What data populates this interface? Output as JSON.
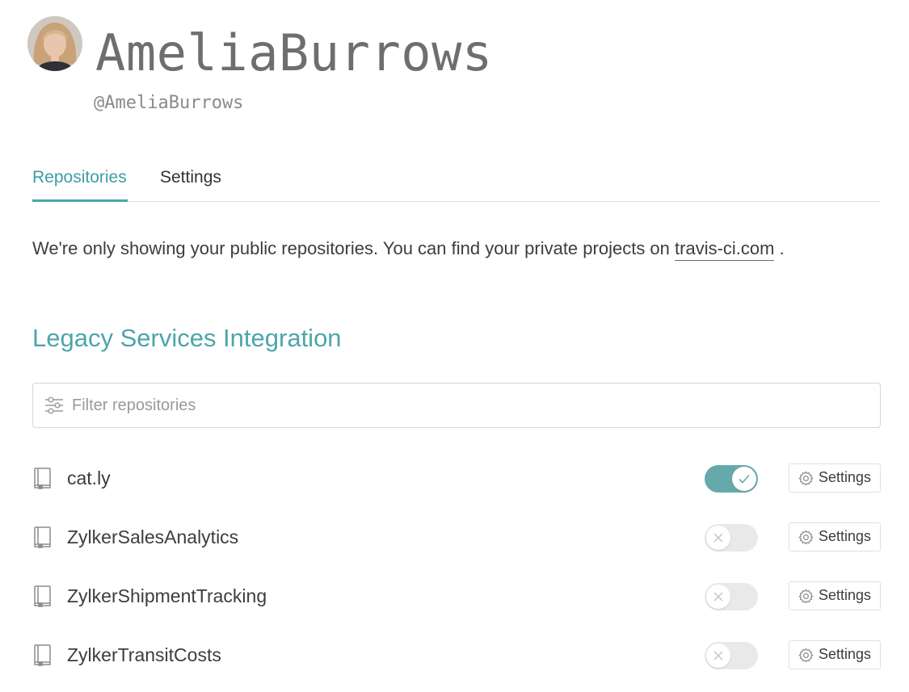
{
  "profile": {
    "display_name": "AmeliaBurrows",
    "handle": "@AmeliaBurrows"
  },
  "tabs": [
    {
      "label": "Repositories",
      "active": true
    },
    {
      "label": "Settings",
      "active": false
    }
  ],
  "notice": {
    "text_before": "We're only showing your public repositories. You can find your private projects on ",
    "link_text": "travis-ci.com",
    "text_after": " ."
  },
  "section": {
    "title": "Legacy Services Integration"
  },
  "filter": {
    "placeholder": "Filter repositories",
    "value": "",
    "icon": "sliders-icon"
  },
  "repositories": [
    {
      "name": "cat.ly",
      "enabled": true,
      "settings_label": "Settings"
    },
    {
      "name": "ZylkerSalesAnalytics",
      "enabled": false,
      "settings_label": "Settings"
    },
    {
      "name": "ZylkerShipmentTracking",
      "enabled": false,
      "settings_label": "Settings"
    },
    {
      "name": "ZylkerTransitCosts",
      "enabled": false,
      "settings_label": "Settings"
    }
  ],
  "colors": {
    "accent": "#48a6ab",
    "toggle_on": "#66a9ad",
    "toggle_off": "#e9e9e9",
    "text": "#3d3d3d"
  }
}
